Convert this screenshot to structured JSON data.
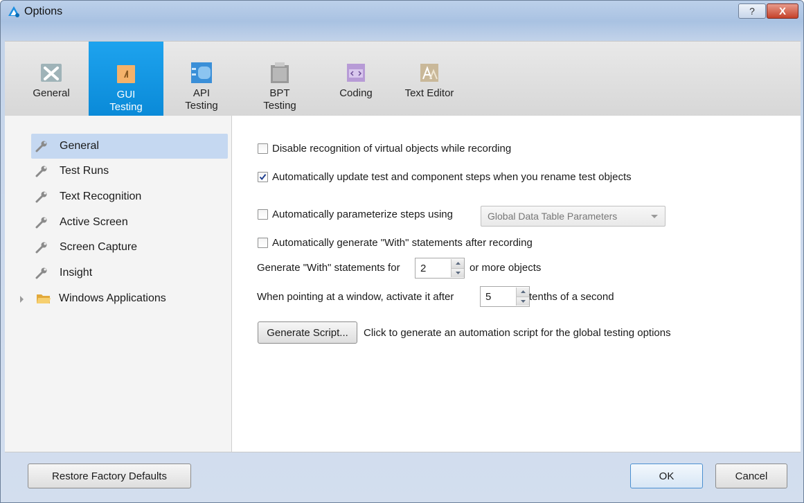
{
  "window": {
    "title": "Options",
    "help_label": "?",
    "close_label": "X"
  },
  "tabs": [
    {
      "label_line1": "General",
      "label_line2": "",
      "icon": "tools-icon"
    },
    {
      "label_line1": "GUI",
      "label_line2": "Testing",
      "icon": "gui-testing-icon",
      "active": true
    },
    {
      "label_line1": "API",
      "label_line2": "Testing",
      "icon": "api-testing-icon"
    },
    {
      "label_line1": "BPT",
      "label_line2": "Testing",
      "icon": "bpt-testing-icon"
    },
    {
      "label_line1": "Coding",
      "label_line2": "",
      "icon": "coding-icon"
    },
    {
      "label_line1": "Text Editor",
      "label_line2": "",
      "icon": "text-editor-icon"
    }
  ],
  "sidebar": {
    "items": [
      {
        "label": "General",
        "selected": true
      },
      {
        "label": "Test Runs"
      },
      {
        "label": "Text Recognition"
      },
      {
        "label": "Active Screen"
      },
      {
        "label": "Screen Capture"
      },
      {
        "label": "Insight"
      }
    ],
    "folder": {
      "label": "Windows Applications",
      "icon": "folder-icon"
    }
  },
  "options": {
    "disable_virtual": {
      "label": "Disable recognition of virtual objects while recording",
      "checked": false
    },
    "auto_update": {
      "label": "Automatically update test and component steps when you rename test objects",
      "checked": true
    },
    "auto_param": {
      "label": "Automatically parameterize steps using",
      "checked": false
    },
    "param_source": {
      "value": "Global Data Table Parameters"
    },
    "auto_with": {
      "label": "Automatically generate \"With\" statements after recording",
      "checked": false
    },
    "with_count": {
      "prefix": "Generate \"With\" statements for",
      "value": "2",
      "suffix": "or more objects"
    },
    "activate_after": {
      "prefix": "When pointing at a window, activate it after",
      "value": "5",
      "suffix": "tenths of a second"
    },
    "generate_script": {
      "button": "Generate Script...",
      "description": "Click to generate an automation script for the global testing options"
    }
  },
  "footer": {
    "restore_label": "Restore Factory Defaults",
    "ok_label": "OK",
    "cancel_label": "Cancel"
  }
}
